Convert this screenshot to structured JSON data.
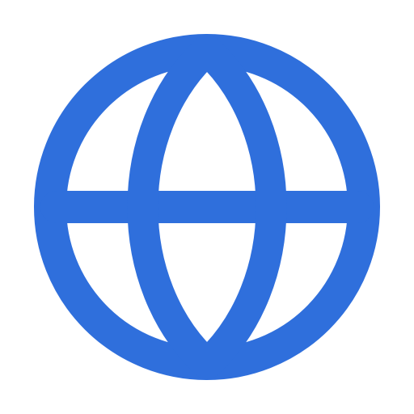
{
  "icon": {
    "name": "globe-icon",
    "color": "#2F6FDC",
    "background": "#ffffff"
  }
}
